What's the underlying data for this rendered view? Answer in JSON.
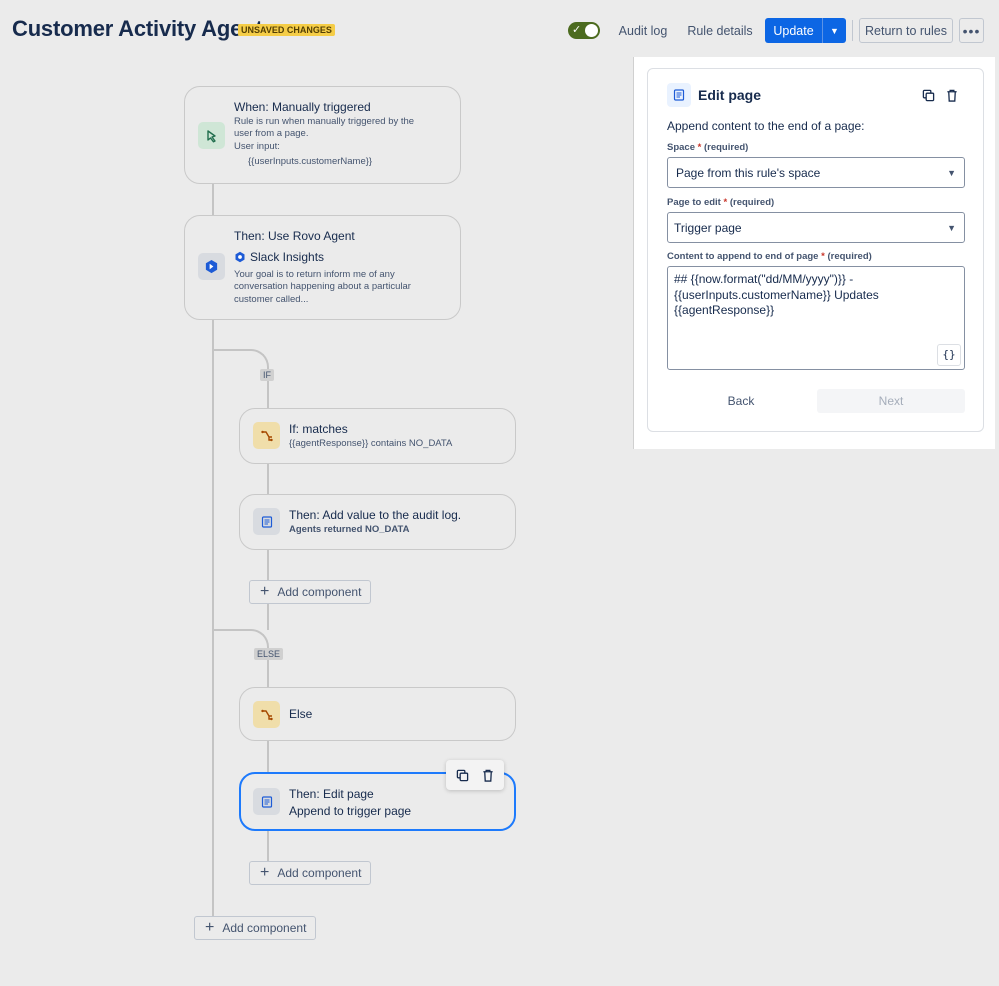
{
  "header": {
    "title": "Customer Activity Agent",
    "badge": "UNSAVED CHANGES",
    "audit_log": "Audit log",
    "rule_details": "Rule details",
    "update": "Update",
    "return_to_rules": "Return to rules",
    "more": "•••",
    "toggle_on": true
  },
  "flow": {
    "trigger": {
      "title": "When: Manually triggered",
      "desc1": "Rule is run when manually triggered by the",
      "desc2": "user from a page.",
      "desc3": "User input:",
      "desc4": "{{userInputs.customerName}}"
    },
    "rovo": {
      "title": "Then: Use Rovo Agent",
      "agent_name": "Slack Insights",
      "desc1": "Your goal is to return inform me of any",
      "desc2": "conversation happening about a particular",
      "desc3": "customer called..."
    },
    "if_tag": "IF",
    "if_card": {
      "title": "If: matches",
      "desc": "{{agentResponse}} contains NO_DATA"
    },
    "audit_card": {
      "title": "Then: Add value to the audit log.",
      "desc": "Agents returned NO_DATA"
    },
    "add_component_1": "Add component",
    "else_tag": "ELSE",
    "else_card": {
      "title": "Else"
    },
    "edit_card": {
      "title": "Then: Edit page",
      "desc": "Append to trigger page"
    },
    "add_component_2": "Add component",
    "add_component_3": "Add component"
  },
  "panel": {
    "title": "Edit page",
    "description": "Append content to the end of a page:",
    "space_label": "Space",
    "space_required": "(required)",
    "space_value": "Page from this rule's space",
    "page_label": "Page to edit",
    "page_required": "(required)",
    "page_value": "Trigger page",
    "content_label": "Content to append to end of page",
    "content_required": "(required)",
    "content_line1": "## {{now.format(\"dd/MM/yyyy\")}} -",
    "content_line2": "{{userInputs.customerName}} Updates",
    "content_line3": "{{agentResponse}}",
    "brace": "{}",
    "back": "Back",
    "next": "Next"
  },
  "colors": {
    "accent": "#0c66e4",
    "selected_border": "#1d7afc",
    "badge_bg": "#f5cd47",
    "toggle": "#4c6b1f"
  }
}
